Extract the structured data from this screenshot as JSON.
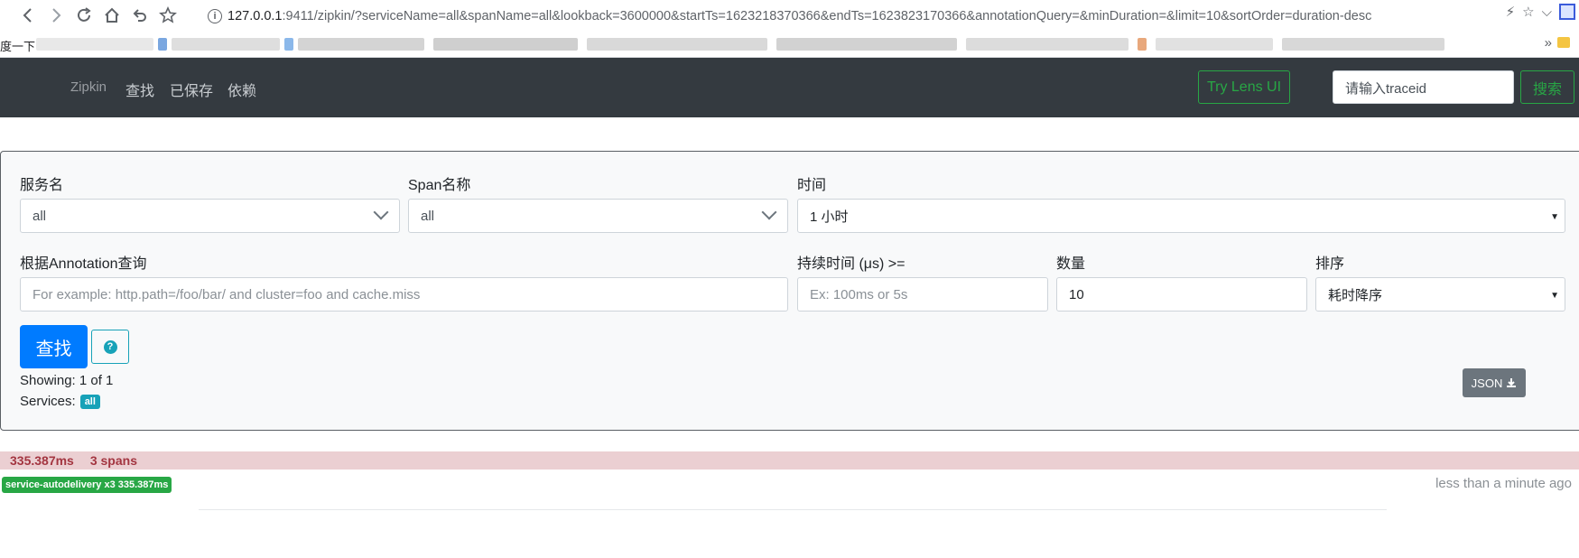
{
  "browser": {
    "url_host": "127.0.0.1",
    "url_rest": ":9411/zipkin/?serviceName=all&spanName=all&lookback=3600000&startTs=1623218370366&endTs=1623823170366&annotationQuery=&minDuration=&limit=10&sortOrder=duration-desc",
    "bookmark_first": "度一下"
  },
  "navbar": {
    "brand": "Zipkin",
    "links": [
      "查找",
      "已保存",
      "依赖"
    ],
    "lens_button": "Try Lens UI",
    "trace_placeholder": "请输入traceid",
    "search_button": "搜索"
  },
  "search": {
    "service_label": "服务名",
    "service_value": "all",
    "span_label": "Span名称",
    "span_value": "all",
    "time_label": "时间",
    "time_value": "1 小时",
    "annotation_label": "根据Annotation查询",
    "annotation_placeholder": "For example: http.path=/foo/bar/ and cluster=foo and cache.miss",
    "duration_label": "持续时间 (μs) >=",
    "duration_placeholder": "Ex: 100ms or 5s",
    "limit_label": "数量",
    "limit_value": "10",
    "sort_label": "排序",
    "sort_value": "耗时降序",
    "find_button": "查找",
    "showing": "Showing: 1 of 1",
    "services_label": "Services:",
    "services_badge": "all",
    "json_button": "JSON"
  },
  "result": {
    "duration": "335.387ms",
    "spans": "3 spans",
    "service_badge": "service-autodelivery x3 335.387ms",
    "time_ago": "less than a minute ago"
  },
  "colors": {
    "navbar_bg": "#343a40",
    "primary": "#007bff",
    "success": "#28a745",
    "info": "#17a2b8",
    "trace_bar": "#ebcfd2"
  }
}
